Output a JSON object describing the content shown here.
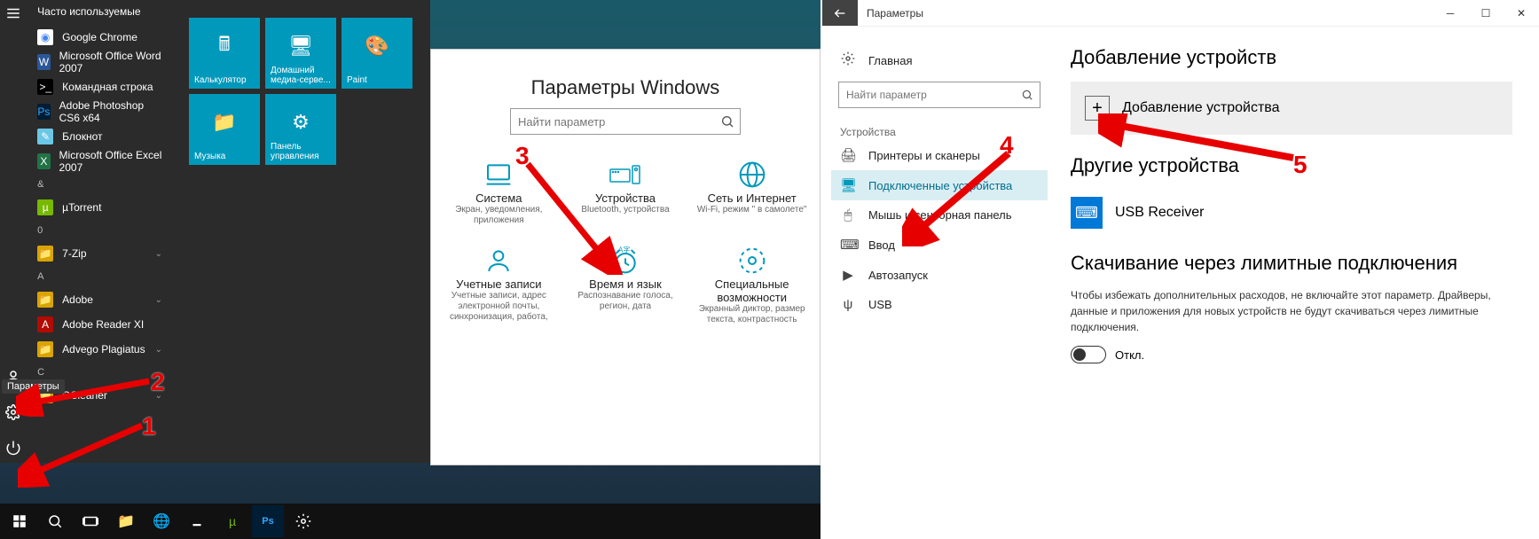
{
  "annotations": {
    "n1": "1",
    "n2": "2",
    "n3": "3",
    "n4": "4",
    "n5": "5"
  },
  "tooltip": {
    "params": "Параметры"
  },
  "start": {
    "frequent_header": "Часто используемые",
    "apps": [
      {
        "label": "Google Chrome",
        "bg": "#fff",
        "fg": "#4285f4",
        "glyph": "◉"
      },
      {
        "label": "Microsoft Office Word 2007",
        "bg": "#2b579a",
        "fg": "#fff",
        "glyph": "W"
      },
      {
        "label": "Командная строка",
        "bg": "#000",
        "fg": "#fff",
        "glyph": ">_"
      },
      {
        "label": "Adobe Photoshop CS6 x64",
        "bg": "#001d34",
        "fg": "#31a8ff",
        "glyph": "Ps"
      },
      {
        "label": "Блокнот",
        "bg": "#6cc7e6",
        "fg": "#fff",
        "glyph": "✎"
      },
      {
        "label": "Microsoft Office Excel 2007",
        "bg": "#217346",
        "fg": "#fff",
        "glyph": "X"
      }
    ],
    "groups": [
      {
        "letter": "&",
        "items": [
          {
            "label": "µTorrent",
            "bg": "#76b900",
            "fg": "#fff",
            "glyph": "µ",
            "chev": false
          }
        ]
      },
      {
        "letter": "0",
        "items": [
          {
            "label": "7-Zip",
            "bg": "#d9a400",
            "fg": "#222",
            "glyph": "📁",
            "chev": true
          }
        ]
      },
      {
        "letter": "A",
        "items": [
          {
            "label": "Adobe",
            "bg": "#d9a400",
            "fg": "#222",
            "glyph": "📁",
            "chev": true
          },
          {
            "label": "Adobe Reader XI",
            "bg": "#b30b00",
            "fg": "#fff",
            "glyph": "A",
            "chev": false
          },
          {
            "label": "Advego Plagiatus",
            "bg": "#d9a400",
            "fg": "#222",
            "glyph": "📁",
            "chev": true
          }
        ]
      },
      {
        "letter": "C",
        "items": [
          {
            "label": "CCleaner",
            "bg": "#d9a400",
            "fg": "#222",
            "glyph": "📁",
            "chev": true
          }
        ]
      }
    ],
    "tiles": [
      {
        "label": "Калькулятор"
      },
      {
        "label": "Домашний медиа-серве..."
      },
      {
        "label": "Paint"
      },
      {
        "label": "Музыка"
      },
      {
        "label": "Панель управления"
      }
    ]
  },
  "mini": {
    "breadcrumb": "аметры",
    "title": "Параметры Windows",
    "search_ph": "Найти параметр",
    "cats": [
      {
        "t": "Система",
        "s": "Экран, уведомления, приложения"
      },
      {
        "t": "Устройства",
        "s": "Bluetooth, устройства"
      },
      {
        "t": "Сеть и Интернет",
        "s": "Wi-Fi, режим \" в самолете\""
      },
      {
        "t": "Учетные записи",
        "s": "Учетные записи, адрес электронной почты, синхронизация, работа,"
      },
      {
        "t": "Время и язык",
        "s": "Распознавание голоса, регион, дата"
      },
      {
        "t": "Специальные возможности",
        "s": "Экранный диктор, размер текста, контрастность"
      }
    ]
  },
  "right": {
    "window_title": "Параметры",
    "home": "Главная",
    "search_ph": "Найти параметр",
    "side_heading": "Устройства",
    "side_items": [
      {
        "label": "Принтеры и сканеры"
      },
      {
        "label": "Подключенные устройства"
      },
      {
        "label": "Мышь и сенсорная панель"
      },
      {
        "label": "Ввод"
      },
      {
        "label": "Автозапуск"
      },
      {
        "label": "USB"
      }
    ],
    "h1": "Добавление устройств",
    "add_label": "Добавление устройства",
    "h2a": "Другие устройства",
    "device": "USB Receiver",
    "h2b": "Скачивание через лимитные подключения",
    "desc": "Чтобы избежать дополнительных расходов, не включайте этот параметр. Драйверы, данные и приложения для новых устройств не будут скачиваться через лимитные подключения.",
    "toggle_label": "Откл."
  }
}
